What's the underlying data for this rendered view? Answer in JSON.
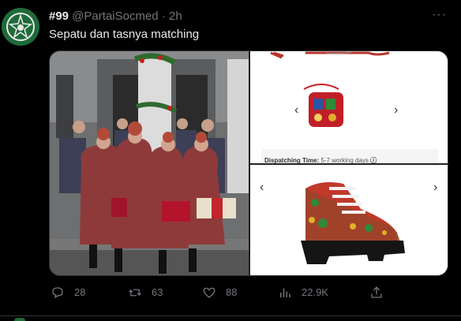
{
  "tweet": {
    "display_name": "#99",
    "handle": "@PartaiSocmed",
    "separator": "·",
    "time": "2h",
    "text": "Sepatu dan tasnya matching",
    "more_icon": "more-horizontal-icon"
  },
  "media": {
    "dispatch_label": "Dispatching Time:",
    "dispatch_value": "5-7 working days",
    "prev_glyph": "‹",
    "next_glyph": "›"
  },
  "actions": {
    "replies": "28",
    "retweets": "63",
    "likes": "88",
    "views": "22.9K"
  },
  "colors": {
    "background": "#000000",
    "text": "#e7e9ea",
    "muted": "#71767b",
    "avatar": "#1f6b3a"
  }
}
